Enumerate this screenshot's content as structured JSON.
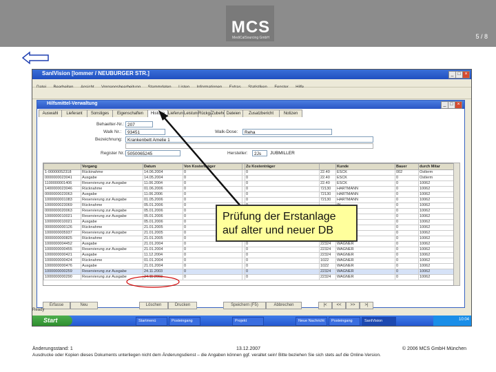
{
  "slide": {
    "logo_text": "MCS",
    "logo_sub": "MediCalSourcing GmbH",
    "page_number": "5 / 8"
  },
  "app": {
    "title": "SanIVision  [lommer / NEUBURGER STR.]",
    "menu": [
      "Datei",
      "Bearbeiten",
      "Ansicht",
      "Vorgangsbearbeitung",
      "Stammdaten",
      "Listen",
      "Informationen",
      "Extras",
      "Statistiken",
      "Fenster",
      "Hilfe"
    ],
    "window_buttons": [
      "_",
      "□",
      "×"
    ]
  },
  "child": {
    "title": "Hilfsmittel-Verwaltung",
    "tabs": [
      "Auswahl",
      "Lieferant",
      "Sonstiges",
      "Eigenschaften",
      "Historie",
      "Lieferungen",
      "Leistungen",
      "Rückgabe",
      "Zubehör",
      "Dateien",
      "Zusatzbericht",
      "Notizen"
    ],
    "active_tab_index": 4
  },
  "fields": {
    "behaelter_label": "Behaelter-Nr.:",
    "behaelter_value": "207",
    "walk_nr_label": "Walk Nr.:",
    "walk_nr_value": "93451",
    "walk_dose_label": "Walk-Dose:",
    "walk_dose_value": "Reha",
    "bezeichnung_label": "Bezeichnung:",
    "bezeichnung_value": "Krankenbett Amelie 1",
    "register_label": "Register Nr.:",
    "register_value": "5050065245",
    "hersteller_label": "Hersteller:",
    "hersteller_code": "2Js",
    "hersteller_name": "JUBMILLER"
  },
  "grid": {
    "headers": [
      "",
      "Vorgang",
      "Datum",
      "Von Kostenträger",
      "",
      "Zu Kostenträger",
      "",
      "Kunde",
      "Bauer",
      "durch Mitar"
    ],
    "rows": [
      [
        "1-00000052318",
        "Rückinahme",
        "14.06.2004",
        "0",
        "",
        "0",
        "22.40",
        "ESCK",
        "002",
        "Ostlerm"
      ],
      [
        "0000000023041",
        "Ausgabe",
        "14.05.2004",
        "0",
        "",
        "0",
        "22.40",
        "ESCK",
        "0",
        "Ostlerm"
      ],
      [
        "1100000001406",
        "Reservierung zur Ausgabe",
        "11.06.2004",
        "0",
        "",
        "0",
        "22.40",
        "ESCK",
        "0",
        "10062"
      ],
      [
        "1400000023046",
        "Rücknahme",
        "01.06.2006",
        "0",
        "",
        "0",
        "72130",
        "HARTMANN",
        "0",
        "10062"
      ],
      [
        "0000000023063",
        "Ausgabe",
        "11.06.2006",
        "0",
        "",
        "0",
        "72130",
        "HARTMANN",
        "0",
        "10062"
      ],
      [
        "1000000001083",
        "Reservierung zur Ausgabe",
        "01.05.2006",
        "0",
        "",
        "0",
        "72130",
        "HARTMANN",
        "0",
        "10062"
      ],
      [
        "1000000023069",
        "Rücknahme",
        "05.01.2006",
        "0",
        "",
        "0",
        "",
        "IN",
        "0",
        "10062"
      ],
      [
        "0000000020063",
        "Reservierung zur Ausgabe",
        "05.01.2006",
        "0",
        "",
        "0",
        "",
        "IN",
        "0",
        "10062"
      ],
      [
        "1000000010021",
        "Reservierung zur Ausgabe",
        "05.01.2006",
        "0",
        "",
        "0",
        "",
        "IN",
        "0",
        "10062"
      ],
      [
        "1000000010021",
        "Ausgabe",
        "05.01.2006",
        "0",
        "",
        "0",
        "",
        "IN",
        "0",
        "10062"
      ],
      [
        "0000000000126",
        "Rücknahme",
        "21.01.2005",
        "0",
        "",
        "0",
        "",
        "",
        "0",
        "10062"
      ],
      [
        "1000000005937",
        "Reservierung zur Ausgabe",
        "21.01.2005",
        "0",
        "",
        "0",
        "",
        "",
        "0",
        "10062"
      ],
      [
        "0000000000825",
        "Rücknahme",
        "21.01.2005",
        "0",
        "",
        "0",
        "",
        "",
        "0",
        "10062"
      ],
      [
        "1000000004452",
        "Ausgabe",
        "21.01.2004",
        "0",
        "",
        "0",
        "22324",
        "WAGNER",
        "0",
        "10062"
      ],
      [
        "1000000000455",
        "Reservierung zur Ausgabe",
        "21.01.2004",
        "0",
        "",
        "0",
        "22324",
        "WAGNER",
        "0",
        "10062"
      ],
      [
        "1000000000421",
        "Ausgabe",
        "11.12.2004",
        "0",
        "",
        "0",
        "22324",
        "WAGNER",
        "0",
        "10062"
      ],
      [
        "1000000000424",
        "Rücknahme",
        "01.01.2004",
        "0",
        "",
        "0",
        "1022",
        "WAGNER",
        "0",
        "10062"
      ],
      [
        "1000000000476",
        "Ausgabe",
        "21.01.2004",
        "0",
        "",
        "0",
        "1022",
        "WAGNER",
        "0",
        "10062"
      ],
      [
        "1000000000259",
        "Reservierung zur Ausgabe",
        "24.11.2003",
        "0",
        "",
        "0",
        "22324",
        "WAGNER",
        "0",
        "10062"
      ],
      [
        "1000000000290",
        "Reservierung zur Ausgabe",
        "24.11.2003",
        "0",
        "",
        "0",
        "22324",
        "WAGNER",
        "0",
        "10062"
      ]
    ],
    "selected_row": 18
  },
  "bottom_buttons": [
    "Erfasse",
    "Neu",
    "Löschen",
    "Drucken",
    "Speichern (F5)",
    "Abbrechen"
  ],
  "nav_buttons": [
    "|<",
    "<<",
    ">>",
    ">|"
  ],
  "status": "Ready",
  "taskbar": {
    "start_label": "Start",
    "tasks": [
      "Startmenü",
      "Posteingang",
      "Projekt",
      "Neue Nachricht",
      "Posteingang",
      "SanIVision"
    ],
    "clock": "10:04"
  },
  "callout": {
    "line1": "Prüfung der Erstanlage",
    "line2": "auf alter und neuer DB"
  },
  "footer": {
    "version": "Änderungsstand: 1",
    "date": "13.12.2007",
    "copyright": "© 2006 MCS GmbH München",
    "disclaimer": "Ausdrucke oder Kopien dieses Dokuments unterliegen nicht dem Änderungsdienst – die Angaben können ggf. veraltet sein! Bitte beziehen Sie sich stets auf die Online-Version."
  },
  "colors": {
    "header_gray": "#8c8c8c",
    "callout_fill": "#ffff9c",
    "highlight_ellipse": "#d00000",
    "xp_blue": "#2458d0"
  }
}
